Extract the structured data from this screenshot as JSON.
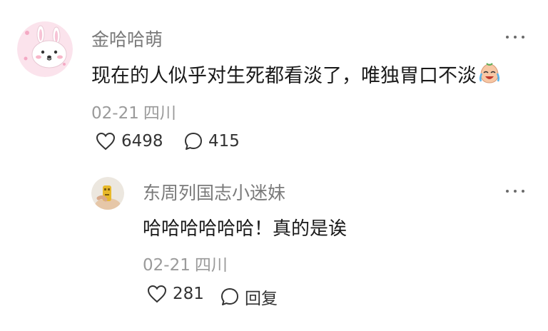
{
  "comments": [
    {
      "username": "金哈哈萌",
      "text": "现在的人似乎对生死都看淡了，唯独胃口不淡",
      "emoji": "crying-laughing-face-emoji",
      "date": "02-21",
      "location": "四川",
      "likes": "6498",
      "replies": "415",
      "avatar": "pink-bunny-avatar"
    },
    {
      "username": "东周列国志小迷妹",
      "text": "哈哈哈哈哈哈！真的是诶",
      "date": "02-21",
      "location": "四川",
      "likes": "281",
      "reply_label": "回复",
      "avatar": "yellow-figure-avatar"
    }
  ],
  "colors": {
    "username": "#7a7a7a",
    "meta": "#9a9a9a",
    "text": "#1a1a1a",
    "avatar_bg_pink": "#f9dde8"
  }
}
